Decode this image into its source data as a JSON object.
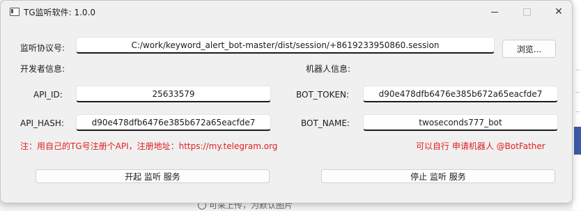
{
  "window": {
    "title": "TG监听软件: 1.0.0",
    "icon": "app-window-icon",
    "controls": {
      "minimize": "minimize-icon",
      "maximize": "maximize-icon",
      "close": "✕"
    }
  },
  "protocol": {
    "label": "监听协议号:",
    "value": "C:/work/keyword_alert_bot-master/dist/session/+8619233950860.session",
    "browse_label": "浏览..."
  },
  "developer": {
    "heading": "开发者信息:",
    "api_id_label": "API_ID:",
    "api_id_value": "25633579",
    "api_hash_label": "API_HASH:",
    "api_hash_value": "d90e478dfb6476e385b672a65eacfde7",
    "note": "注：用自己的TG号注册个API，注册地址：https://my.telegram.org"
  },
  "bot": {
    "heading": "机器人信息:",
    "token_label": "BOT_TOKEN:",
    "token_value": "d90e478dfb6476e385b672a65eacfde7",
    "name_label": "BOT_NAME:",
    "name_value": "twoseconds777_bot",
    "note": "可以自行 申请机器人  @BotFather"
  },
  "actions": {
    "start_label": "开起 监听 服务",
    "stop_label": "停止 监听 服务"
  },
  "background": {
    "bottom_text": "可采上传，为默认图片"
  },
  "colors": {
    "note_red": "#e0201e",
    "field_underline": "#1b1b1b",
    "background_accent": "#3d5aa8"
  }
}
